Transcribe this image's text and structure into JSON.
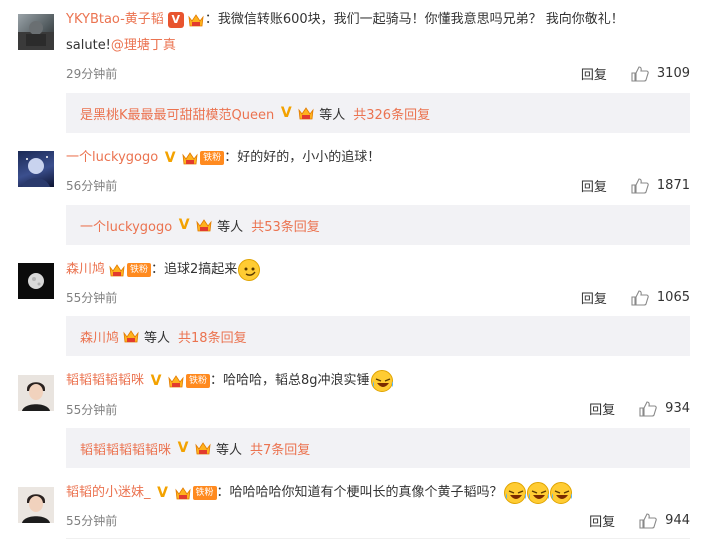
{
  "comments": [
    {
      "username": "YKYBtao-黄子韬",
      "text": "：我微信转账600块，我们一起骑马！你懂我意思吗兄弟？ 我向你敬礼！",
      "text2": "salute!",
      "mention": "@理塘丁真",
      "time": "29分钟前",
      "reply_label": "回复",
      "likes": "3109",
      "sub": {
        "names": "是黑桃K最最最可甜甜模范Queen",
        "etc": "等人",
        "total": "共326条回复"
      }
    },
    {
      "username": "一个luckygogo",
      "fan_badge": "铁粉",
      "text": "：好的好的，小小的追球！",
      "time": "56分钟前",
      "reply_label": "回复",
      "likes": "1871",
      "sub": {
        "names": "一个luckygogo",
        "etc": "等人",
        "total": "共53条回复"
      }
    },
    {
      "username": "森川鸠",
      "fan_badge": "铁粉",
      "text": "：追球2搞起来",
      "time": "55分钟前",
      "reply_label": "回复",
      "likes": "1065",
      "sub": {
        "names": "森川鸠",
        "etc": "等人",
        "total": "共18条回复"
      }
    },
    {
      "username": "韬韬韬韬韬咪",
      "fan_badge": "铁粉",
      "text": "：哈哈哈，韬总8g冲浪实锤",
      "time": "55分钟前",
      "reply_label": "回复",
      "likes": "934",
      "sub": {
        "names": "韬韬韬韬韬韬咪",
        "etc": "等人",
        "total": "共7条回复"
      }
    },
    {
      "username": "韬韬的小迷妹_",
      "fan_badge": "铁粉",
      "text": "：哈哈哈哈你知道有个梗叫长的真像个黄子韬吗？",
      "time": "55分钟前",
      "reply_label": "回复",
      "likes": "944"
    }
  ],
  "colors": {
    "username": "#eb7350",
    "time": "#808080",
    "sub_bg": "#f2f2f5"
  },
  "icons": [
    "verified-v-icon",
    "crown-badge-icon",
    "fan-badge-icon",
    "smirk-emoji-icon",
    "laugh-cry-emoji-icon",
    "thumbs-up-icon"
  ]
}
